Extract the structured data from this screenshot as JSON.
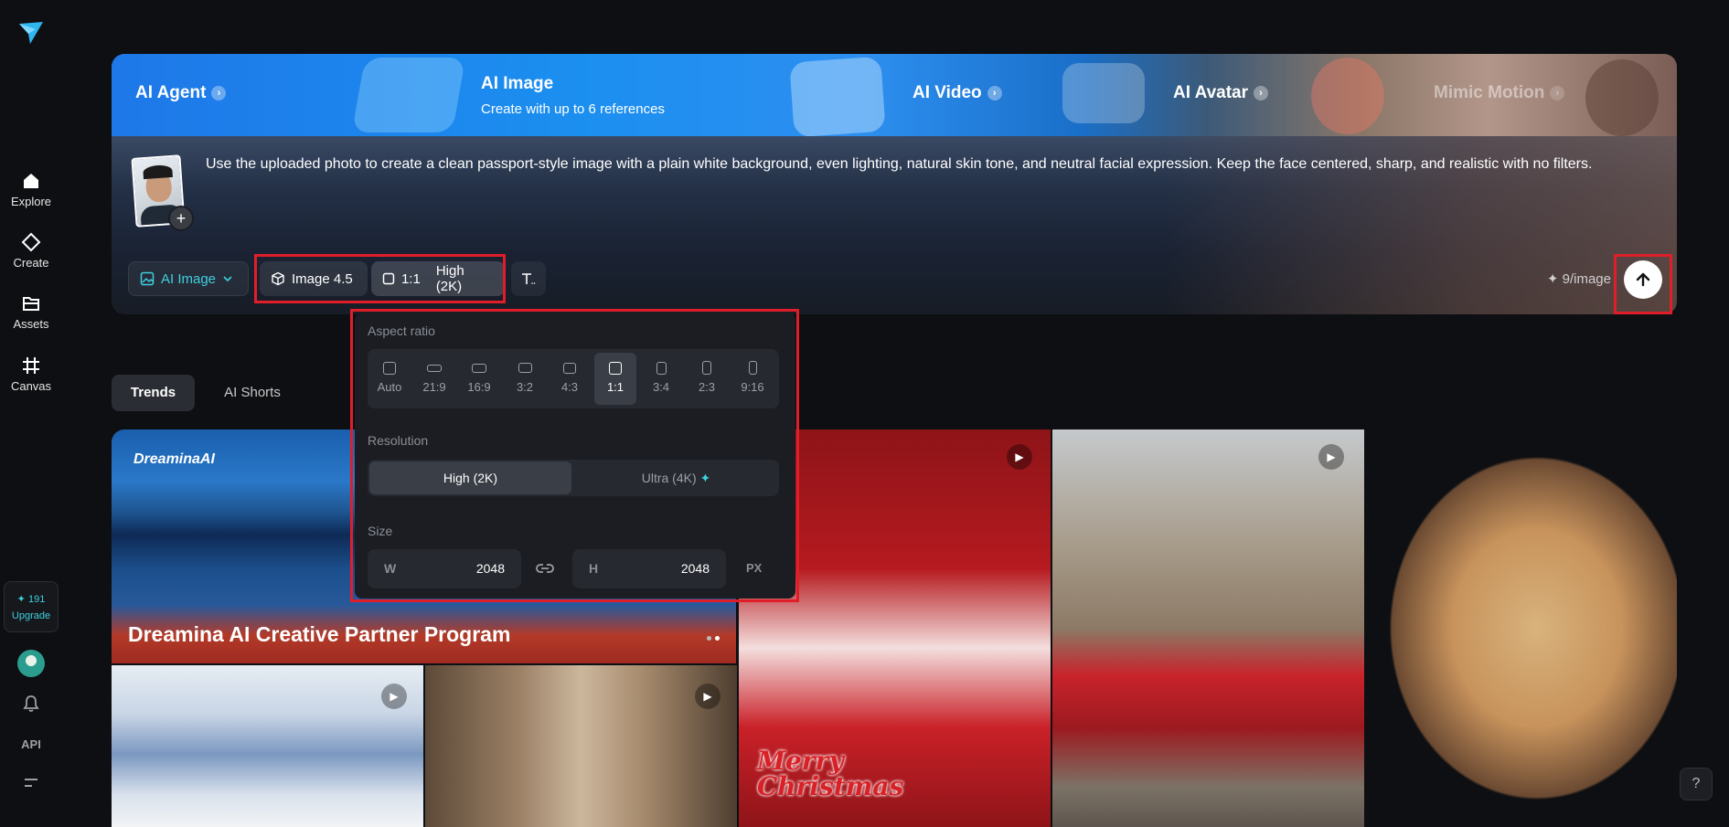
{
  "sidebar": {
    "logo_icon": "dreamina-paper-plane-logo",
    "items": [
      {
        "label": "Explore",
        "icon": "home-icon"
      },
      {
        "label": "Create",
        "icon": "diamond-icon"
      },
      {
        "label": "Assets",
        "icon": "folder-icon"
      },
      {
        "label": "Canvas",
        "icon": "grid-icon"
      }
    ],
    "credits": "191",
    "upgrade_label": "Upgrade",
    "api_label": "API"
  },
  "banner": {
    "tabs": [
      "AI Agent",
      "AI Image",
      "AI Video",
      "AI Avatar",
      "Mimic Motion"
    ],
    "ai_image_subtitle": "Create with up to 6 references",
    "chevron": "›"
  },
  "prompt": {
    "text": "Use the uploaded photo to create a clean passport-style image with a plain white background, even lighting, natural skin tone, and neutral facial expression. Keep the face centered, sharp, and realistic with no filters.",
    "add_label": "+"
  },
  "toolbar": {
    "mode_label": "AI Image",
    "model_label": "Image 4.5",
    "ratio_label": "1:1",
    "quality_label": "High (2K)",
    "cost_label": "9/image",
    "accent": "#3fd0e0"
  },
  "popover": {
    "aspect_title": "Aspect ratio",
    "ratios": [
      "Auto",
      "21:9",
      "16:9",
      "3:2",
      "4:3",
      "1:1",
      "3:4",
      "2:3",
      "9:16"
    ],
    "selected_ratio": "1:1",
    "resolution_title": "Resolution",
    "resolutions": [
      "High (2K)",
      "Ultra (4K)"
    ],
    "selected_resolution": "High (2K)",
    "size_title": "Size",
    "width_label": "W",
    "width_value": "2048",
    "height_label": "H",
    "height_value": "2048",
    "unit": "PX"
  },
  "tabs": [
    "Trends",
    "AI Shorts"
  ],
  "gallery": {
    "promo_brand": "DreaminaAI",
    "promo_title": "Dreamina AI Creative Partner Program",
    "xmas_text_1": "Merry",
    "xmas_text_2": "Christmas"
  },
  "help_label": "?",
  "highlight_color": "#e01e2a"
}
